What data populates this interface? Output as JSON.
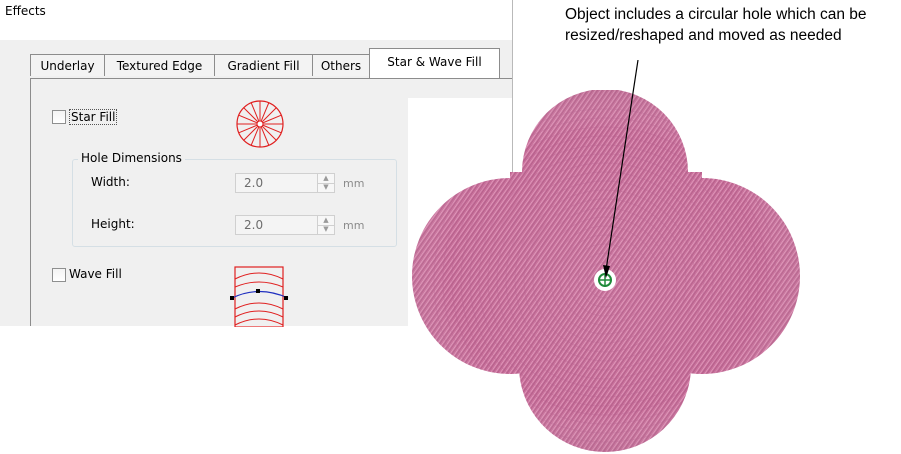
{
  "dialog": {
    "title": "Effects",
    "tabs": [
      {
        "label": "Underlay"
      },
      {
        "label": "Textured Edge"
      },
      {
        "label": "Gradient Fill"
      },
      {
        "label": "Others"
      },
      {
        "label": "Star & Wave Fill",
        "active": true
      }
    ],
    "star_fill": {
      "label": "Star Fill",
      "checked": false
    },
    "hole_dimensions": {
      "title": "Hole Dimensions",
      "width": {
        "label": "Width:",
        "value": "2.0",
        "unit": "mm"
      },
      "height": {
        "label": "Height:",
        "value": "2.0",
        "unit": "mm"
      }
    },
    "wave_fill": {
      "label": "Wave Fill",
      "checked": false
    }
  },
  "annotation": {
    "text": "Object includes a circular hole which can be resized/reshaped and moved as needed"
  },
  "colors": {
    "embroidery_pink": "#c9709b",
    "preview_red": "#e02020",
    "wave_blue": "#2030c0",
    "hole_marker_green": "#1f8a3a"
  }
}
